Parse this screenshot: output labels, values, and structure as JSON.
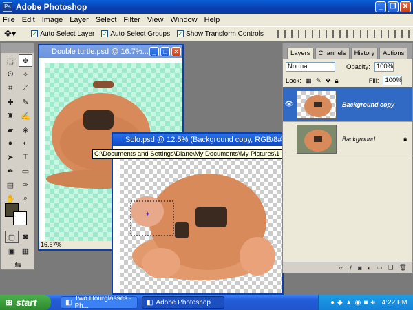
{
  "app": {
    "title": "Adobe Photoshop"
  },
  "menu": [
    "File",
    "Edit",
    "Image",
    "Layer",
    "Select",
    "Filter",
    "View",
    "Window",
    "Help"
  ],
  "options": {
    "auto_select_layer": "Auto Select Layer",
    "auto_select_groups": "Auto Select Groups",
    "show_transform_controls": "Show Transform Controls"
  },
  "doc1": {
    "title": "Double turtle.psd @ 16.7%...",
    "zoom": "16.67%"
  },
  "doc2": {
    "title": "Solo.psd @ 12.5% (Background copy, RGB/8#)"
  },
  "tooltip": "C:\\Documents and Settings\\Diane\\My Documents\\My Pictures\\1 Pyxleyes\\Turtle\\Solo.psd @ 12.5% (Background copy, RGB/8#)",
  "layers_panel": {
    "tabs": [
      "Layers",
      "Channels",
      "History",
      "Actions"
    ],
    "blend_mode": "Normal",
    "opacity_label": "Opacity:",
    "opacity": "100%",
    "lock_label": "Lock:",
    "fill_label": "Fill:",
    "fill": "100%",
    "layers": [
      {
        "name": "Background copy",
        "selected": true
      },
      {
        "name": "Background",
        "selected": false
      }
    ]
  },
  "taskbar": {
    "start": "start",
    "tasks": [
      "Two Hourglasses - Ph...",
      "Adobe Photoshop"
    ],
    "clock": "4:22 PM"
  },
  "colors": {
    "titlebar": "#0a3fb0",
    "selection": "#316ac5",
    "turtle": "#d98a5a",
    "start": "#3c9a3c"
  },
  "icons": [
    "move-icon",
    "photoshop-logo-icon",
    "eye-icon",
    "lock-icon",
    "minimize-icon",
    "maximize-icon",
    "close-icon"
  ]
}
